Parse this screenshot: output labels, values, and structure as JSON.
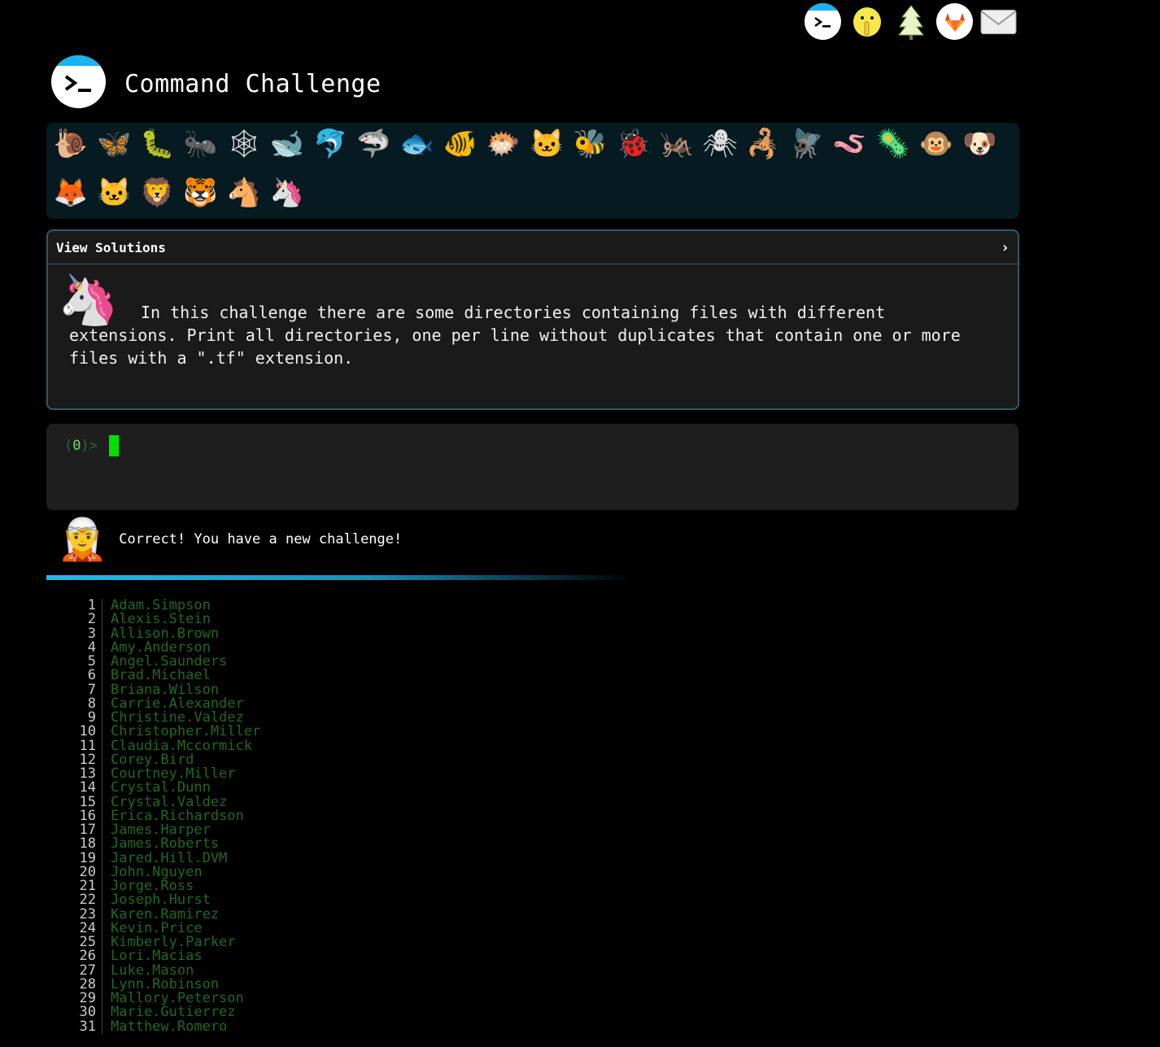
{
  "site": {
    "title": "Command Challenge"
  },
  "top_nav": [
    {
      "name": "terminal-home-icon",
      "glyph": ""
    },
    {
      "name": "shushing-face-icon",
      "glyph": "🤫"
    },
    {
      "name": "tree-icon",
      "glyph": "🌲"
    },
    {
      "name": "gitlab-icon",
      "glyph": ""
    },
    {
      "name": "mail-icon",
      "glyph": "✉"
    }
  ],
  "levels": [
    {
      "name": "snail-icon",
      "glyph": "🐌"
    },
    {
      "name": "butterfly-icon",
      "glyph": "🦋"
    },
    {
      "name": "caterpillar-icon",
      "glyph": "🐛"
    },
    {
      "name": "ant-icon",
      "glyph": "🐜"
    },
    {
      "name": "spider-web-icon",
      "glyph": "🕸"
    },
    {
      "name": "whale-icon",
      "glyph": "🐋"
    },
    {
      "name": "dolphin-icon",
      "glyph": "🐬"
    },
    {
      "name": "shark-icon",
      "glyph": "🦈"
    },
    {
      "name": "fish-icon",
      "glyph": "🐟"
    },
    {
      "name": "tropical-fish-icon",
      "glyph": "🐠"
    },
    {
      "name": "blowfish-icon",
      "glyph": "🐡"
    },
    {
      "name": "cat-face-icon",
      "glyph": "🐱"
    },
    {
      "name": "bee-icon",
      "glyph": "🐝"
    },
    {
      "name": "ladybug-icon",
      "glyph": "🐞"
    },
    {
      "name": "cricket-icon",
      "glyph": "🦗"
    },
    {
      "name": "spider-icon",
      "glyph": "🕷"
    },
    {
      "name": "scorpion-icon",
      "glyph": "🦂"
    },
    {
      "name": "fly-icon",
      "glyph": "🪰"
    },
    {
      "name": "worm-icon",
      "glyph": "🪱"
    },
    {
      "name": "microbe-icon",
      "glyph": "🦠"
    },
    {
      "name": "monkey-face-icon",
      "glyph": "🐵"
    },
    {
      "name": "dog-face-icon",
      "glyph": "🐶"
    },
    {
      "name": "fox-face-icon",
      "glyph": "🦊"
    },
    {
      "name": "cat-face-2-icon",
      "glyph": "🐱"
    },
    {
      "name": "lion-face-icon",
      "glyph": "🦁"
    },
    {
      "name": "tiger-face-icon",
      "glyph": "🐯"
    },
    {
      "name": "horse-face-icon",
      "glyph": "🐴"
    },
    {
      "name": "unicorn-face-icon",
      "glyph": "🦄"
    }
  ],
  "solutions": {
    "header": "View Solutions",
    "toggle": "›",
    "unicorn": "🦄",
    "description": "In this challenge there are some directories containing files with different extensions. Print all directories, one per line without duplicates that contain one or more files with a \".tf\" extension."
  },
  "terminal": {
    "prompt_open": "(",
    "prompt_count": "0",
    "prompt_close": ")>"
  },
  "status": {
    "face": "🧝",
    "message": "Correct! You have a new challenge!"
  },
  "output_lines": [
    "Adam.Simpson",
    "Alexis.Stein",
    "Allison.Brown",
    "Amy.Anderson",
    "Angel.Saunders",
    "Brad.Michael",
    "Briana.Wilson",
    "Carrie.Alexander",
    "Christine.Valdez",
    "Christopher.Miller",
    "Claudia.Mccormick",
    "Corey.Bird",
    "Courtney.Miller",
    "Crystal.Dunn",
    "Crystal.Valdez",
    "Erica.Richardson",
    "James.Harper",
    "James.Roberts",
    "Jared.Hill.DVM",
    "John.Nguyen",
    "Jorge.Ross",
    "Joseph.Hurst",
    "Karen.Ramirez",
    "Kevin.Price",
    "Kimberly.Parker",
    "Lori.Macias",
    "Luke.Mason",
    "Lynn.Robinson",
    "Mallory.Peterson",
    "Marie.Gutierrez",
    "Matthew.Romero"
  ]
}
